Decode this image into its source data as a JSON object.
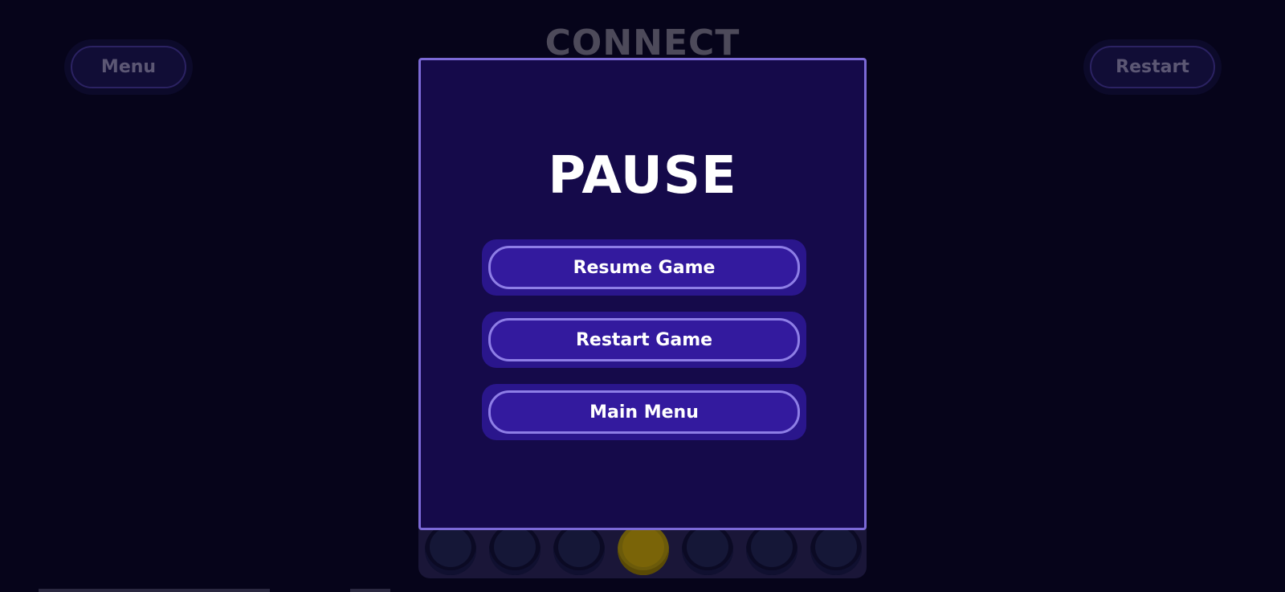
{
  "game": {
    "title": "CONNECT",
    "menu_label": "Menu",
    "restart_label": "Restart"
  },
  "board": {
    "visible_slots": [
      "empty",
      "empty",
      "empty",
      "yellow",
      "empty",
      "empty",
      "empty"
    ]
  },
  "pause_modal": {
    "title": "PAUSE",
    "buttons": [
      {
        "label": "Resume Game"
      },
      {
        "label": "Restart Game"
      },
      {
        "label": "Main Menu"
      }
    ]
  },
  "colors": {
    "background": "#06041a",
    "modal_bg": "#150a4a",
    "modal_border": "#7b69d6",
    "button_bg": "#331a9e",
    "button_border": "#8e7ee6",
    "token_yellow": "#7a6408"
  }
}
